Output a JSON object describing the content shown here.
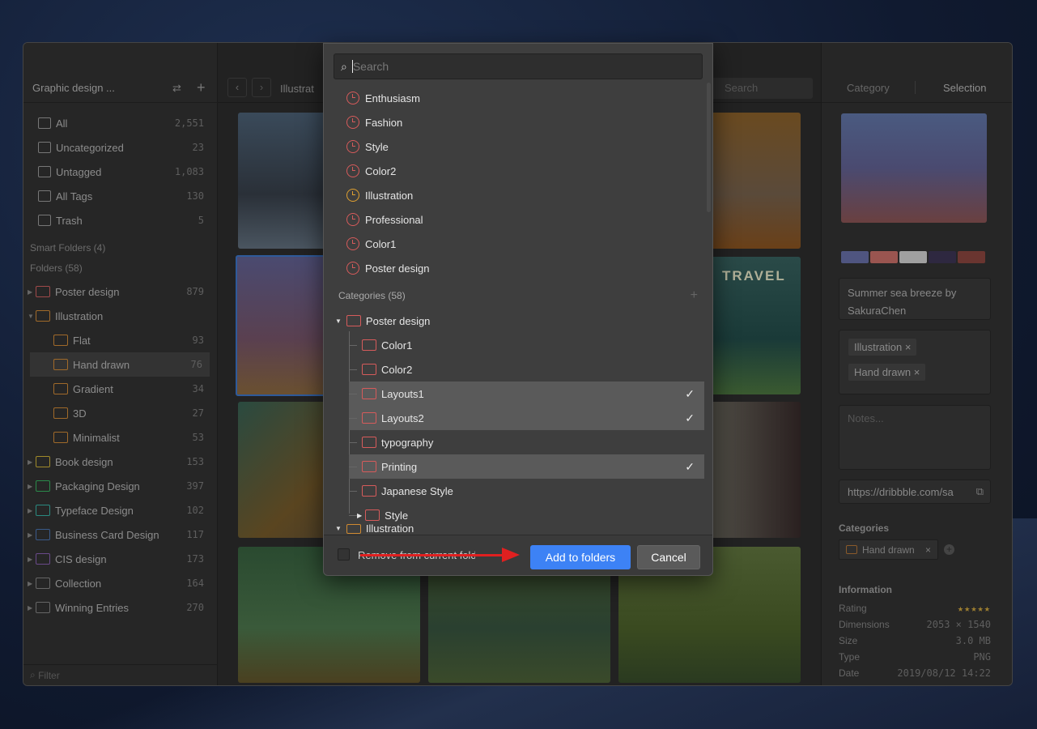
{
  "window": {
    "traffic_lights": [
      "#ec5f57",
      "#e0b93a",
      "#5fc240"
    ]
  },
  "sidebar": {
    "library": "Graphic design ...",
    "filter_placeholder": "Filter",
    "items": [
      {
        "label": "All",
        "count": "2,551"
      },
      {
        "label": "Uncategorized",
        "count": "23"
      },
      {
        "label": "Untagged",
        "count": "1,083"
      },
      {
        "label": "All Tags",
        "count": "130"
      },
      {
        "label": "Trash",
        "count": "5"
      }
    ],
    "smart_folders": "Smart Folders (4)",
    "folders_header": "Folders (58)",
    "folders": [
      {
        "label": "Poster design",
        "count": "879",
        "color": "#a04a4a"
      },
      {
        "label": "Illustration",
        "count": "",
        "color": "#a06a2a"
      },
      {
        "label": "Flat",
        "count": "93",
        "color": "#a06a2a"
      },
      {
        "label": "Hand drawn",
        "count": "76",
        "color": "#a06a2a"
      },
      {
        "label": "Gradient",
        "count": "34",
        "color": "#a06a2a"
      },
      {
        "label": "3D",
        "count": "27",
        "color": "#a06a2a"
      },
      {
        "label": "Minimalist",
        "count": "53",
        "color": "#a06a2a"
      },
      {
        "label": "Book design",
        "count": "153",
        "color": "#a08a2a"
      },
      {
        "label": "Packaging Design",
        "count": "397",
        "color": "#2a8a4a"
      },
      {
        "label": "Typeface Design",
        "count": "102",
        "color": "#2a8a80"
      },
      {
        "label": "Business Card Design",
        "count": "117",
        "color": "#3a5a8a"
      },
      {
        "label": "CIS design",
        "count": "173",
        "color": "#6a4a8a"
      },
      {
        "label": "Collection",
        "count": "164",
        "color": "#666666"
      },
      {
        "label": "Winning Entries",
        "count": "270",
        "color": "#666666"
      }
    ]
  },
  "toolbar": {
    "breadcrumb": "Illustrat",
    "search_placeholder": "Search"
  },
  "grid": {
    "overlay_text": "TRAVEL"
  },
  "inspector": {
    "tabs": [
      "Category",
      "Selection"
    ],
    "palette": [
      "#4f5580",
      "#9a5550",
      "#a0a0a0",
      "#2e2840",
      "#6a3530"
    ],
    "title": "Summer sea breeze by SakuraChen",
    "tags": [
      "Illustration",
      "Hand drawn"
    ],
    "notes_placeholder": "Notes...",
    "url": "https://dribbble.com/sa",
    "categories_label": "Categories",
    "category": "Hand drawn",
    "information_label": "Information",
    "info": [
      {
        "label": "Rating",
        "value": "★★★★★"
      },
      {
        "label": "Dimensions",
        "value": "2053 × 1540"
      },
      {
        "label": "Size",
        "value": "3.0 MB"
      },
      {
        "label": "Type",
        "value": "PNG"
      },
      {
        "label": "Date",
        "value": "2019/08/12 14:22"
      }
    ],
    "rating": 5
  },
  "dialog": {
    "search_placeholder": "Search",
    "recent": [
      {
        "label": "Enthusiasm",
        "color": "#d65b5b"
      },
      {
        "label": "Fashion",
        "color": "#d65b5b"
      },
      {
        "label": "Style",
        "color": "#d65b5b"
      },
      {
        "label": "Color2",
        "color": "#d65b5b"
      },
      {
        "label": "Illustration",
        "color": "#e0a030"
      },
      {
        "label": "Professional",
        "color": "#d65b5b"
      },
      {
        "label": "Color1",
        "color": "#d65b5b"
      },
      {
        "label": "Poster design",
        "color": "#d65b5b"
      }
    ],
    "categories_header": "Categories (58)",
    "parent": "Poster design",
    "children": [
      {
        "label": "Color1",
        "checked": false
      },
      {
        "label": "Color2",
        "checked": false
      },
      {
        "label": "Layouts1",
        "checked": true
      },
      {
        "label": "Layouts2",
        "checked": true
      },
      {
        "label": "typography",
        "checked": false
      },
      {
        "label": "Printing",
        "checked": true
      },
      {
        "label": "Japanese Style",
        "checked": false
      },
      {
        "label": "Style",
        "checked": false
      }
    ],
    "next_parent": "Illustration",
    "remove_label": "Remove from current folder",
    "add_button": "Add to folders",
    "cancel_button": "Cancel",
    "accent": "#3d82f5"
  }
}
